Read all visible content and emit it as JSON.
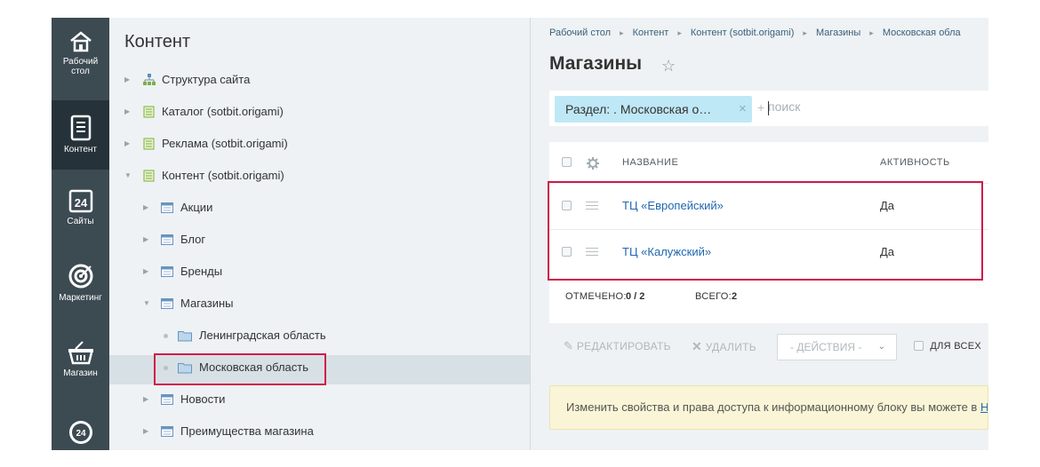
{
  "leftbar": {
    "items": [
      {
        "label": "Рабочий стол",
        "icon": "home-icon"
      },
      {
        "label": "Контент",
        "icon": "document-icon"
      },
      {
        "label": "Сайты",
        "icon": "calendar-24-icon"
      },
      {
        "label": "Маркетинг",
        "icon": "target-icon"
      },
      {
        "label": "Магазин",
        "icon": "basket-icon"
      },
      {
        "label": "",
        "icon": "bitrix24-icon"
      }
    ],
    "item0_line1": "Рабочий",
    "item0_line2": "стол",
    "item1": "Контент",
    "item2": "Сайты",
    "item3": "Маркетинг",
    "item4": "Магазин"
  },
  "tree": {
    "title": "Контент",
    "nodes": [
      {
        "label": "Структура сайта",
        "icon": "structure-icon"
      },
      {
        "label": "Каталог (sotbit.origami)",
        "icon": "iblock-type-icon"
      },
      {
        "label": "Реклама (sotbit.origami)",
        "icon": "iblock-type-icon"
      },
      {
        "label": "Контент (sotbit.origami)",
        "icon": "iblock-type-icon"
      },
      {
        "label": "Акции",
        "icon": "iblock-icon"
      },
      {
        "label": "Блог",
        "icon": "iblock-icon"
      },
      {
        "label": "Бренды",
        "icon": "iblock-icon"
      },
      {
        "label": "Магазины",
        "icon": "iblock-icon"
      },
      {
        "label": "Ленинградская область",
        "icon": "folder-icon"
      },
      {
        "label": "Московская область",
        "icon": "folder-icon"
      },
      {
        "label": "Новости",
        "icon": "iblock-icon"
      },
      {
        "label": "Преимущества магазина",
        "icon": "iblock-icon"
      }
    ]
  },
  "breadcrumbs": [
    "Рабочий стол",
    "Контент",
    "Контент (sotbit.origami)",
    "Магазины",
    "Московская обла"
  ],
  "page": {
    "title": "Магазины"
  },
  "filter": {
    "chip_label": "Раздел: . Московская о…",
    "plus": "+",
    "placeholder": "поиск"
  },
  "grid": {
    "columns": [
      "НАЗВАНИЕ",
      "АКТИВНОСТЬ"
    ],
    "rows": [
      {
        "name": "ТЦ «Европейский»",
        "active": "Да"
      },
      {
        "name": "ТЦ «Калужский»",
        "active": "Да"
      }
    ],
    "selected_label": "ОТМЕЧЕНО:",
    "selected_value": "0 / 2",
    "total_label": "ВСЕГО:",
    "total_value": "2"
  },
  "actions": {
    "edit": "РЕДАКТИРОВАТЬ",
    "delete": "УДАЛИТЬ",
    "select_value": "- ДЕЙСТВИЯ -",
    "for_all": "ДЛЯ ВСЕХ"
  },
  "note": {
    "text": "Изменить свойства и права доступа к информационному блоку вы можете в ",
    "link": "Н"
  },
  "colors": {
    "highlight": "#d0194a",
    "link": "#2067b0",
    "sidebar": "#3c4a52"
  }
}
